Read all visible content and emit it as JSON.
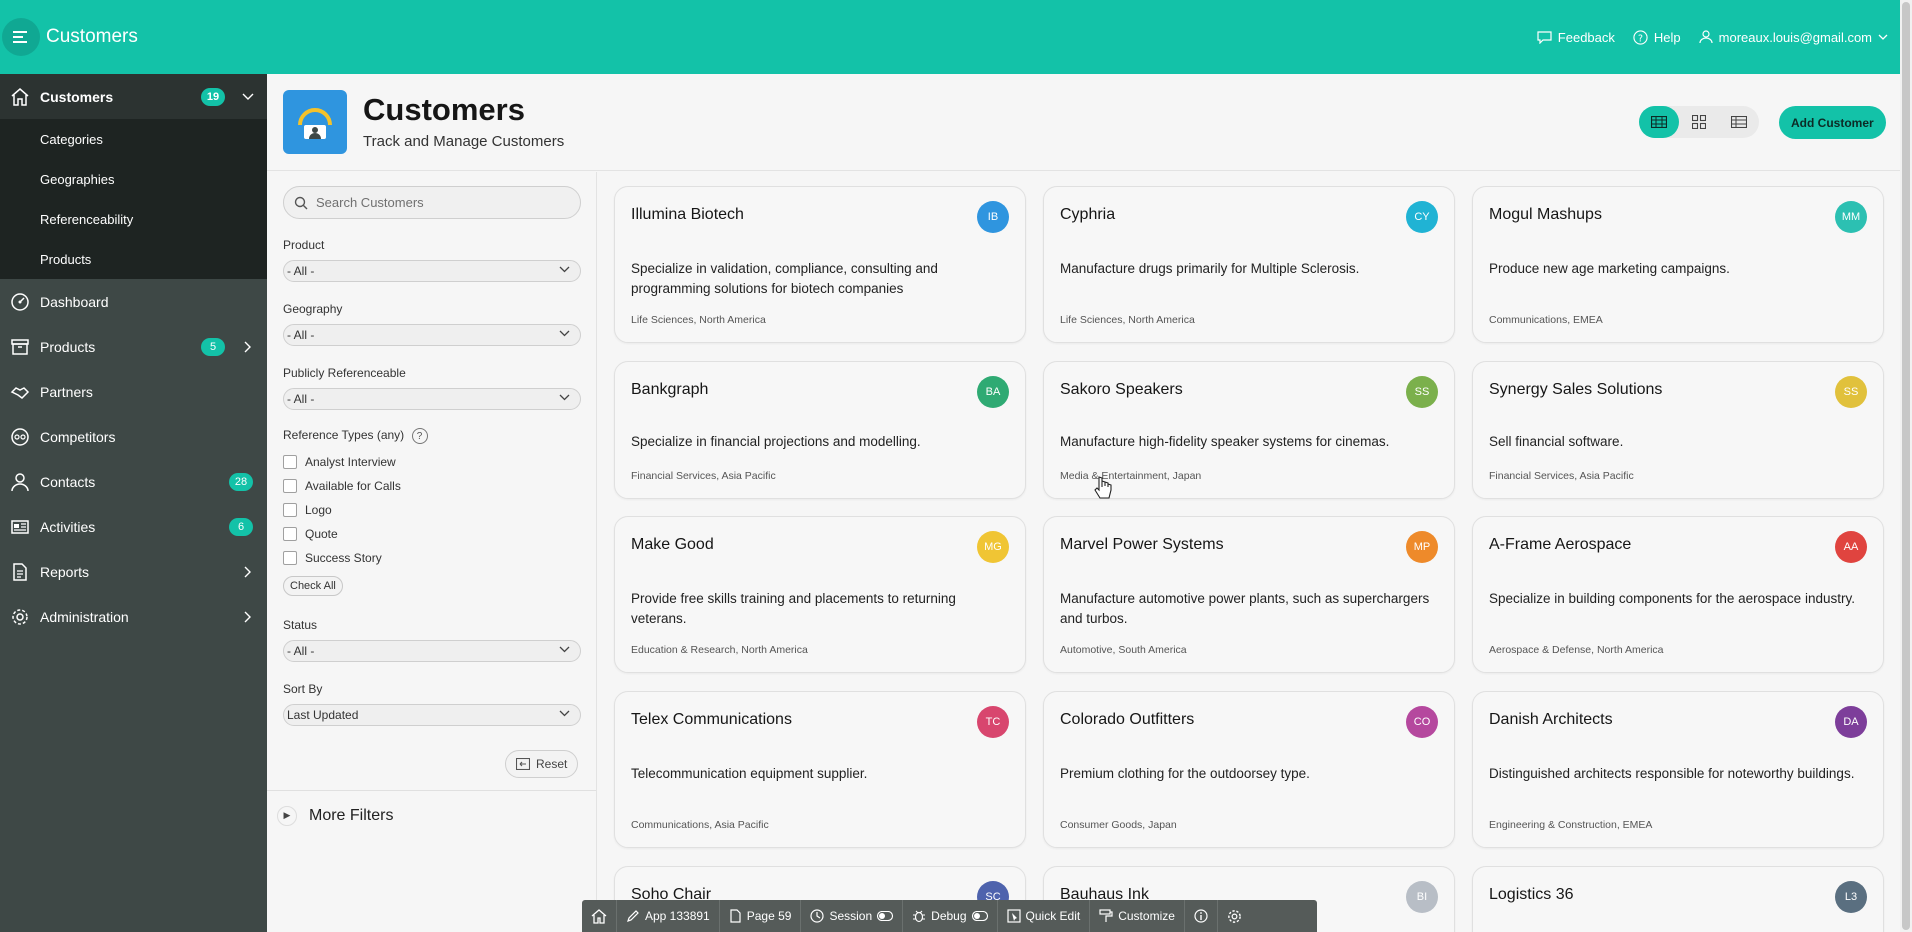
{
  "header": {
    "app_title": "Customers",
    "feedback_label": "Feedback",
    "help_label": "Help",
    "user_email": "moreaux.louis@gmail.com"
  },
  "sidebar": {
    "items": [
      {
        "label": "Customers",
        "badge": "19",
        "icon": "home-icon",
        "active": true
      },
      {
        "label": "Dashboard",
        "icon": "dashboard-icon"
      },
      {
        "label": "Products",
        "badge": "5",
        "icon": "archive-icon"
      },
      {
        "label": "Partners",
        "icon": "handshake-icon"
      },
      {
        "label": "Competitors",
        "icon": "competitors-icon"
      },
      {
        "label": "Contacts",
        "badge": "28",
        "icon": "user-icon"
      },
      {
        "label": "Activities",
        "badge": "6",
        "icon": "newspaper-icon"
      },
      {
        "label": "Reports",
        "icon": "report-icon"
      },
      {
        "label": "Administration",
        "icon": "gear-icon"
      }
    ],
    "submenu": [
      "Categories",
      "Geographies",
      "Referenceability",
      "Products"
    ]
  },
  "page": {
    "title": "Customers",
    "subtitle": "Track and Manage Customers",
    "add_button": "Add Customer"
  },
  "filters": {
    "search_placeholder": "Search Customers",
    "product_label": "Product",
    "product_value": "- All -",
    "geography_label": "Geography",
    "geography_value": "- All -",
    "referenceable_label": "Publicly Referenceable",
    "referenceable_value": "- All -",
    "ref_types_label": "Reference Types (any)",
    "ref_types": [
      "Analyst Interview",
      "Available for Calls",
      "Logo",
      "Quote",
      "Success Story"
    ],
    "check_all": "Check All",
    "status_label": "Status",
    "status_value": "- All -",
    "sort_label": "Sort By",
    "sort_value": "Last Updated",
    "reset": "Reset",
    "more_filters": "More Filters"
  },
  "cards": [
    {
      "name": "Illumina Biotech",
      "initials": "IB",
      "color": "#2f95df",
      "desc": "Specialize in validation, compliance, consulting and programming solutions for biotech companies",
      "meta": "Life Sciences, North America"
    },
    {
      "name": "Cyphria",
      "initials": "CY",
      "color": "#20b3d4",
      "desc": "Manufacture drugs primarily for Multiple Sclerosis.",
      "meta": "Life Sciences, North America"
    },
    {
      "name": "Mogul Mashups",
      "initials": "MM",
      "color": "#2cc0b2",
      "desc": "Produce new age marketing campaigns.",
      "meta": "Communications, EMEA"
    },
    {
      "name": "Bankgraph",
      "initials": "BA",
      "color": "#2faa73",
      "desc": "Specialize in financial projections and modelling.",
      "meta": "Financial Services, Asia Pacific"
    },
    {
      "name": "Sakoro Speakers",
      "initials": "SS",
      "color": "#7bb04c",
      "desc": "Manufacture high-fidelity speaker systems for cinemas.",
      "meta": "Media & Entertainment, Japan"
    },
    {
      "name": "Synergy Sales Solutions",
      "initials": "SS",
      "color": "#e1c13c",
      "desc": "Sell financial software.",
      "meta": "Financial Services, Asia Pacific"
    },
    {
      "name": "Make Good",
      "initials": "MG",
      "color": "#f0c534",
      "desc": "Provide free skills training and placements to returning veterans.",
      "meta": "Education & Research, North America"
    },
    {
      "name": "Marvel Power Systems",
      "initials": "MP",
      "color": "#ee8a2a",
      "desc": "Manufacture automotive power plants, such as superchargers and turbos.",
      "meta": "Automotive, South America"
    },
    {
      "name": "A-Frame Aerospace",
      "initials": "AA",
      "color": "#e0443f",
      "desc": "Specialize in building components for the aerospace industry.",
      "meta": "Aerospace & Defense, North America"
    },
    {
      "name": "Telex Communications",
      "initials": "TC",
      "color": "#d8466e",
      "desc": "Telecommunication equipment supplier.",
      "meta": "Communications, Asia Pacific"
    },
    {
      "name": "Colorado Outfitters",
      "initials": "CO",
      "color": "#b5489e",
      "desc": "Premium clothing for the outdoorsey type.",
      "meta": "Consumer Goods, Japan"
    },
    {
      "name": "Danish Architects",
      "initials": "DA",
      "color": "#7d3e9a",
      "desc": "Distinguished architects responsible for noteworthy buildings.",
      "meta": "Engineering & Construction, EMEA"
    },
    {
      "name": "Soho Chair",
      "initials": "SC",
      "color": "#4e63ad",
      "desc": "",
      "meta": ""
    },
    {
      "name": "Bauhaus Ink",
      "initials": "BI",
      "color": "#b8bec6",
      "desc": "",
      "meta": ""
    },
    {
      "name": "Logistics 36",
      "initials": "L3",
      "color": "#5a6f80",
      "desc": "",
      "meta": ""
    }
  ],
  "devbar": {
    "app": "App 133891",
    "page": "Page 59",
    "session": "Session",
    "debug": "Debug",
    "quick_edit": "Quick Edit",
    "customize": "Customize"
  }
}
